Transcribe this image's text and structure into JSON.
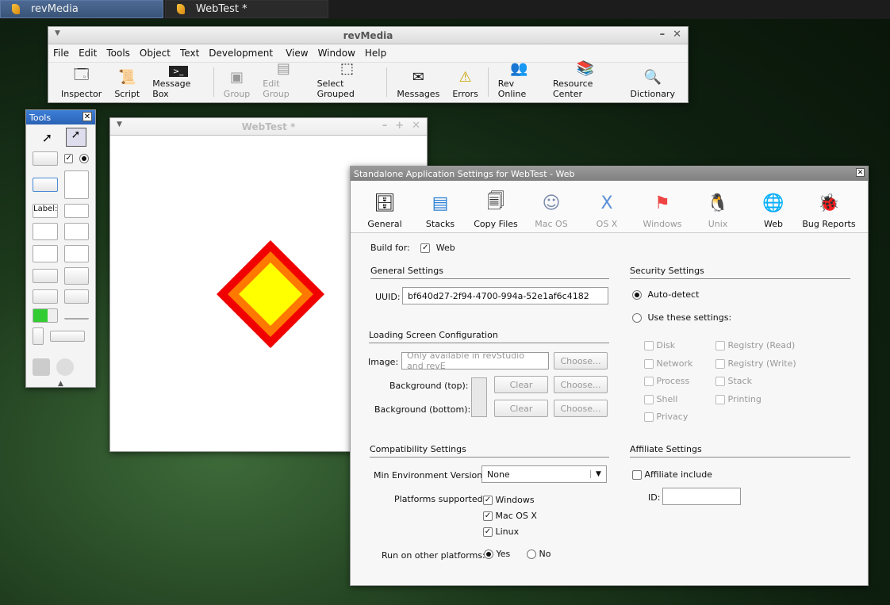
{
  "taskbar": {
    "tasks": [
      "revMedia",
      "WebTest *"
    ]
  },
  "main_window": {
    "title": "revMedia",
    "menu": [
      "File",
      "Edit",
      "Tools",
      "Object",
      "Text",
      "Development",
      "View",
      "Window",
      "Help"
    ],
    "toolbar": [
      "Inspector",
      "Script",
      "Message Box",
      "Group",
      "Edit Group",
      "Select Grouped",
      "Messages",
      "Errors",
      "Rev Online",
      "Resource Center",
      "Dictionary"
    ]
  },
  "tools_palette": {
    "title": "Tools",
    "close": "✕",
    "label_tool": "Label:"
  },
  "webtest": {
    "title": "WebTest *"
  },
  "dialog": {
    "title": "Standalone Application Settings for WebTest - Web",
    "close": "✕",
    "tabs": [
      "General",
      "Stacks",
      "Copy Files",
      "Mac OS",
      "OS X",
      "Windows",
      "Unix",
      "Web",
      "Bug Reports"
    ],
    "build_for_label": "Build for:",
    "build_for_value": "Web",
    "general_settings": "General Settings",
    "uuid_label": "UUID:",
    "uuid_value": "bf640d27-2f94-4700-994a-52e1af6c4182",
    "loading_screen": "Loading Screen Configuration",
    "image_label": "Image:",
    "image_placeholder": "Only available in revStudio and revE",
    "choose": "Choose...",
    "clear": "Clear",
    "bg_top": "Background (top):",
    "bg_bottom": "Background (bottom):",
    "security_settings": "Security Settings",
    "auto_detect": "Auto-detect",
    "use_these": "Use these settings:",
    "security_left": [
      "Disk",
      "Network",
      "Process",
      "Shell",
      "Privacy"
    ],
    "security_right": [
      "Registry (Read)",
      "Registry (Write)",
      "Stack",
      "Printing"
    ],
    "compat": "Compatibility Settings",
    "min_env_label": "Min Environment Version:",
    "min_env_value": "None",
    "platforms_label": "Platforms supported:",
    "platforms": [
      "Windows",
      "Mac OS X",
      "Linux"
    ],
    "run_other_label": "Run on other platforms:",
    "yes": "Yes",
    "no": "No",
    "affiliate": "Affiliate Settings",
    "affiliate_include": "Affiliate include",
    "id_label": "ID:"
  }
}
